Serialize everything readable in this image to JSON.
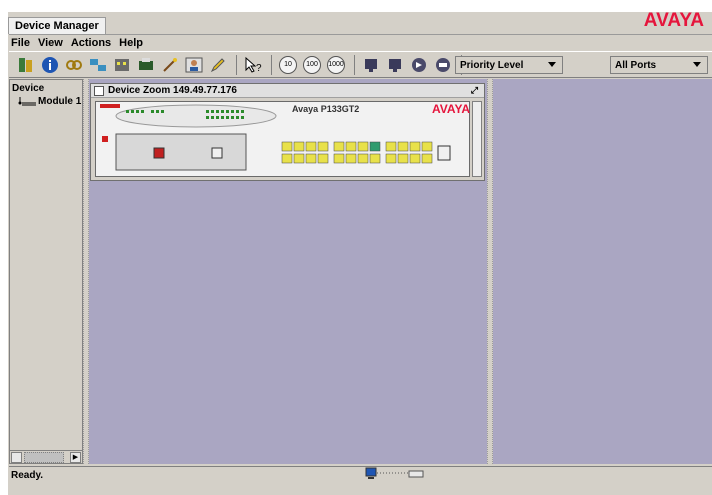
{
  "app": {
    "title": "Device Manager",
    "brand": "AVAYA"
  },
  "menu": [
    "File",
    "View",
    "Actions",
    "Help"
  ],
  "toolbar": {
    "speed_buttons": [
      "10",
      "100",
      "1000"
    ],
    "priority_dropdown": "Priority Level",
    "ports_dropdown": "All Ports"
  },
  "tree": {
    "root": "Device",
    "node": "Module 1"
  },
  "zoom_window": {
    "title": "Device Zoom 149.49.77.176",
    "model": "Avaya P133GT2",
    "brand": "AVAYA"
  },
  "status": {
    "text": "Ready."
  },
  "colors": {
    "brand": "#e5153c",
    "desktop": "#aaa6c2",
    "port": "#e8e14a",
    "port_active": "#2f9b6e"
  }
}
